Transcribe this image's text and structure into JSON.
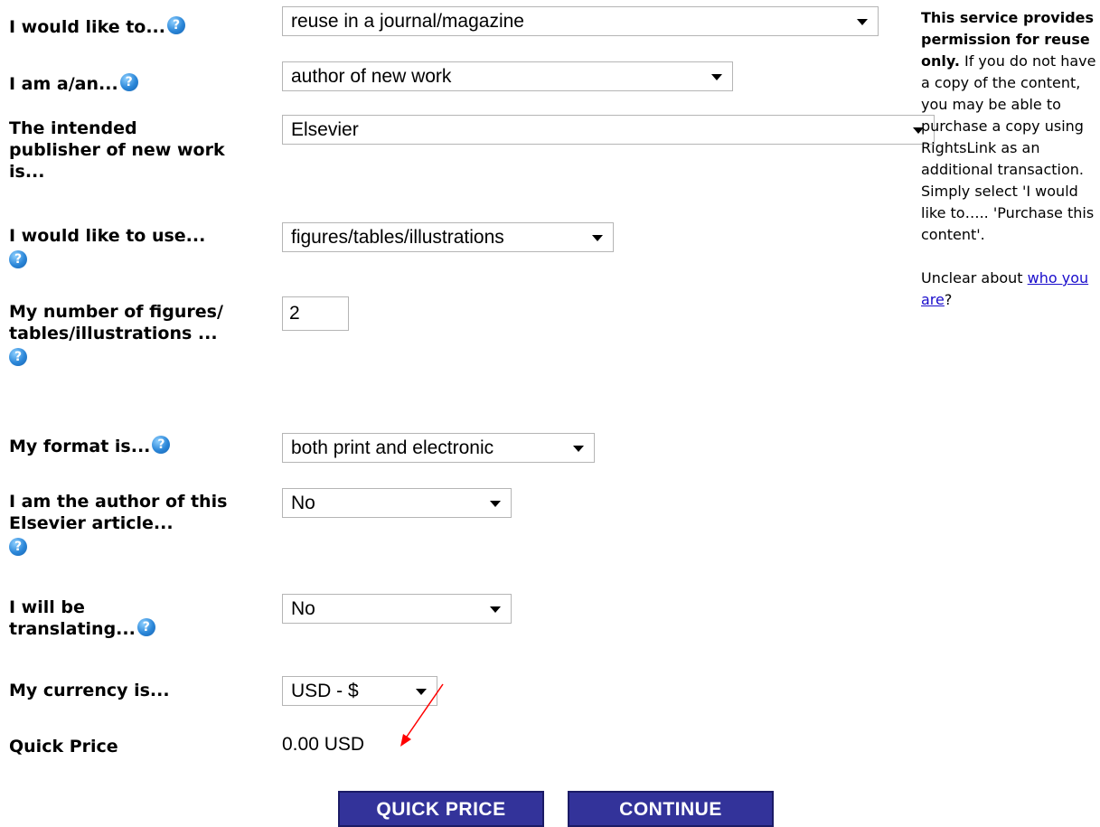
{
  "fields": {
    "would_like_to": {
      "label": "I would like to...",
      "value": "reuse in a journal/magazine"
    },
    "i_am": {
      "label": "I am a/an...",
      "value": "author of new work"
    },
    "publisher": {
      "label": "The intended publisher of new work is...",
      "value": "Elsevier"
    },
    "use": {
      "label": "I would like to use...",
      "value": "figures/tables/illustrations"
    },
    "number": {
      "label": "My number of figures/ tables/illustrations ...",
      "value": "2"
    },
    "format": {
      "label": "My format is...",
      "value": "both print and electronic"
    },
    "author": {
      "label": "I am the author of this Elsevier article...",
      "value": "No"
    },
    "translating": {
      "label": "I will be translating...",
      "value": "No"
    },
    "currency": {
      "label": "My currency is...",
      "value": "USD - $"
    },
    "quick_price": {
      "label": "Quick Price",
      "value": "0.00 USD"
    }
  },
  "help_glyph": "?",
  "buttons": {
    "quick_price": "QUICK PRICE",
    "continue": "CONTINUE"
  },
  "sidebar": {
    "bold_text": "This service provides permission for reuse only.",
    "text": " If you do not have a copy of the content, you may be able to purchase a copy using RightsLink as an additional transaction. Simply select 'I would like to….. 'Purchase this content'.",
    "unclear_text": "Unclear about ",
    "link_text": "who you are",
    "unclear_suffix": "?"
  },
  "colors": {
    "button_bg": "#33339a",
    "help_icon": "#2a86d8",
    "link": "#1a0dcc",
    "annotation_arrow": "#ff0000"
  },
  "icons": {
    "help": "help-question-icon",
    "dropdown": "dropdown-arrow-icon"
  }
}
